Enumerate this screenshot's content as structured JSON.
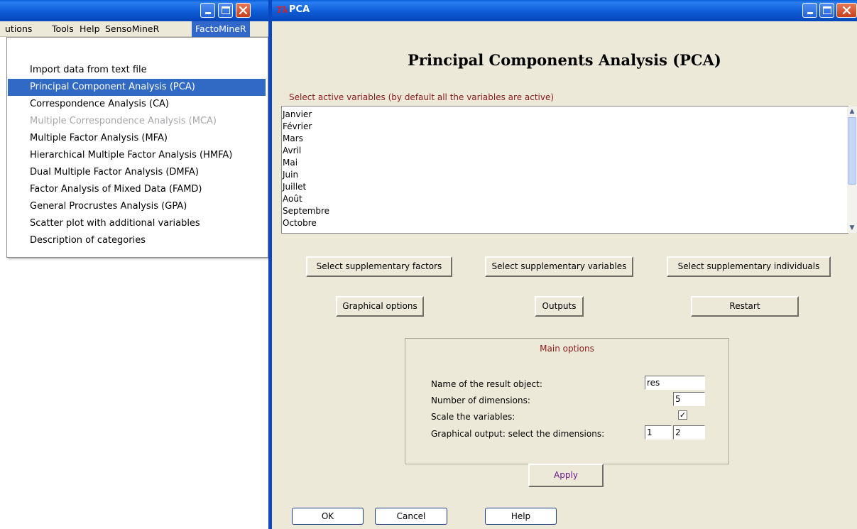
{
  "left_window": {
    "menu_bar": [
      "utions",
      "Tools",
      "Help",
      "SensoMineR",
      "FactoMineR"
    ],
    "dropdown": [
      {
        "label": "Import data from text file",
        "state": "normal"
      },
      {
        "label": "Principal Component Analysis (PCA)",
        "state": "selected"
      },
      {
        "label": "Correspondence Analysis (CA)",
        "state": "normal"
      },
      {
        "label": "Multiple Correspondence Analysis (MCA)",
        "state": "disabled"
      },
      {
        "label": "Multiple Factor Analysis (MFA)",
        "state": "normal"
      },
      {
        "label": "Hierarchical Multiple Factor Analysis (HMFA)",
        "state": "normal"
      },
      {
        "label": "Dual Multiple Factor Analysis (DMFA)",
        "state": "normal"
      },
      {
        "label": "Factor Analysis of Mixed Data (FAMD)",
        "state": "normal"
      },
      {
        "label": "General Procrustes Analysis (GPA)",
        "state": "normal"
      },
      {
        "label": "Scatter plot with additional variables",
        "state": "normal"
      },
      {
        "label": "Description of categories",
        "state": "normal"
      }
    ],
    "title_buttons": [
      "minimize-icon",
      "maximize-icon",
      "close-icon"
    ]
  },
  "pca_window": {
    "app_icon": "Tk",
    "title": "PCA",
    "heading": "Principal Components Analysis (PCA)",
    "active_variables_label": "Select active variables (by default all the variables are active)",
    "variables": [
      "Janvier",
      "Février",
      "Mars",
      "Avril",
      "Mai",
      "Juin",
      "Juillet",
      "Août",
      "Septembre",
      "Octobre"
    ],
    "buttons": {
      "supp_factors": "Select supplementary factors",
      "supp_variables": "Select supplementary variables",
      "supp_individuals": "Select supplementary individuals",
      "graphical_options": "Graphical options",
      "outputs": "Outputs",
      "restart": "Restart",
      "apply": "Apply",
      "ok": "OK",
      "cancel": "Cancel",
      "help": "Help"
    },
    "main_options": {
      "title": "Main options",
      "result_name_label": "Name of the result object:",
      "result_name_value": "res",
      "dimensions_label": "Number of dimensions:",
      "dimensions_value": "5",
      "scale_label": "Scale the variables:",
      "scale_checked": true,
      "scale_check_glyph": "✓",
      "graph_dims_label": "Graphical output: select the dimensions:",
      "graph_dim1": "1",
      "graph_dim2": "2"
    },
    "colors": {
      "accent_red": "#8b1a1a",
      "title_bar_blue": "#0d5bd6",
      "selection_blue": "#316ac5",
      "apply_text": "#6b1a8a"
    }
  }
}
